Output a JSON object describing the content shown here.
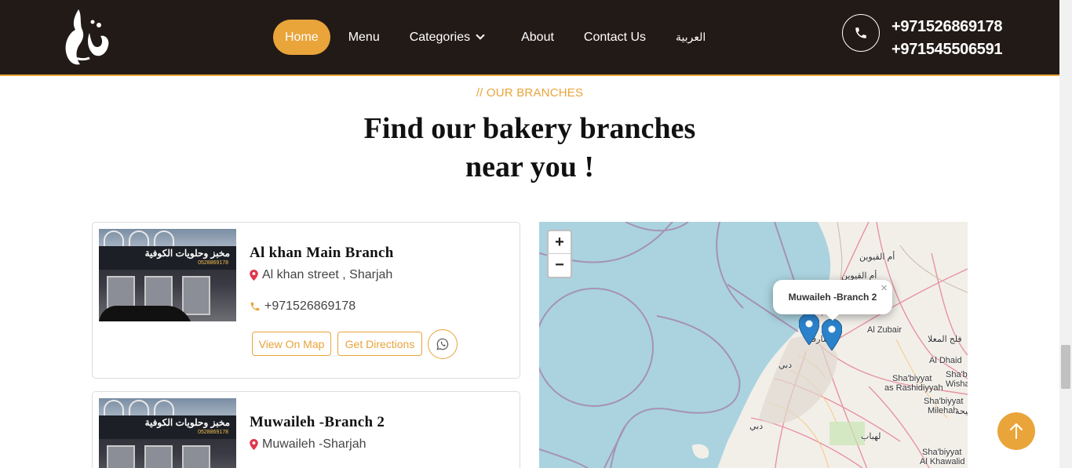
{
  "header": {
    "logo_alt": "الكوفية",
    "nav": [
      {
        "label": "Home",
        "active": true
      },
      {
        "label": "Menu"
      },
      {
        "label": "Categories"
      },
      {
        "label": "About"
      },
      {
        "label": "Contact Us"
      },
      {
        "label": "العربية"
      }
    ],
    "phones": [
      "+971526869178",
      "+971545506591"
    ],
    "phone_icon": "phone-icon"
  },
  "section": {
    "eyebrow": "// OUR BRANCHES",
    "title_line1": "Find our bakery branches",
    "title_line2": "near you !"
  },
  "branches": [
    {
      "name": "Al khan Main Branch",
      "address": "Al khan street , Sharjah",
      "phone": "+971526869178",
      "view_label": "View On Map",
      "directions_label": "Get Directions",
      "sign_text": "مخبز وحلويات الكوفية",
      "sign_phone": "0528869178"
    },
    {
      "name": "Muwaileh -Branch 2",
      "address": "Muwaileh -Sharjah",
      "sign_text": "مخبز وحلويات الكوفية",
      "sign_phone": "0528869178"
    }
  ],
  "map": {
    "zoom_in": "+",
    "zoom_out": "−",
    "popup": "Muwaileh -Branch 2",
    "popup_close": "×",
    "labels": {
      "umm_al_quwain_ar": "أم القيوين",
      "umm_al_quwain_ar2": "أم القيوين",
      "al_zubair": "Al Zubair",
      "falaj_al_mualla": "فلج المعلا",
      "al_dhaid": "Al Dhaid",
      "shabiyyat_1": "Sha'bi",
      "wisha": "Wisha",
      "shabiyyat_rashidiyyah_1": "Sha'biyyat",
      "shabiyyat_rashidiyyah_2": "as Rashidiyyah",
      "shabiyyat_milehah_1": "Sha'biyyat",
      "shabiyyat_milehah_2": "Milehah",
      "milehah_ar": "مليحة",
      "lahbab": "لهباب",
      "dubai_ar": "دبي",
      "dubai_ar2": "دبي",
      "sharjah_ar": "شارقة",
      "shabiyyat_khawalid_1": "Sha'biyyat",
      "shabiyyat_khawalid_2": "Al Khawalid"
    }
  },
  "colors": {
    "accent": "#e9a43a",
    "header_bg": "#221a17",
    "sea": "#aad3df",
    "land": "#f2efe9"
  }
}
